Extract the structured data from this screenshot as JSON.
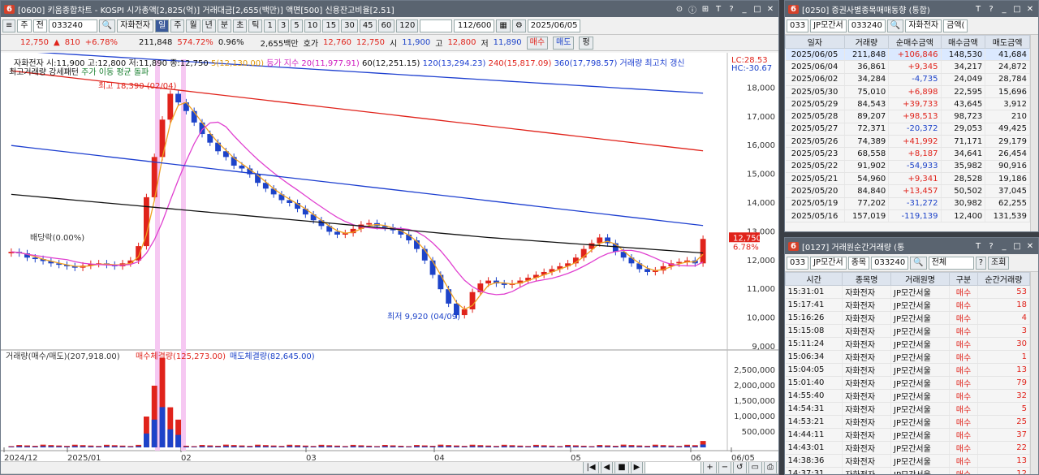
{
  "main": {
    "window_num": "6",
    "title": "[0600] 키움종합차트 - KOSPI 시가총액[2,825(억)] 거래대금[2,655(백만)] 액면[500] 신용잔고비율[2.51]",
    "toolbar1": {
      "period_type": "주",
      "prev_label": "전",
      "code": "033240",
      "stock_name": "자화전자",
      "btn_il": "일",
      "btn_ju": "주",
      "btn_wol": "월",
      "btn_nyeon": "년",
      "btn_bun": "분",
      "btn_cho": "초",
      "btn_tick": "틱",
      "n1": "1",
      "n3": "3",
      "n5": "5",
      "n10": "10",
      "n15": "15",
      "n30": "30",
      "n45": "45",
      "n60": "60",
      "n120": "120",
      "count": "112/600",
      "date": "2025/06/05"
    },
    "toolbar2": {
      "price": "12,750",
      "change": "810",
      "rate": "+6.78%",
      "volume": "211,848",
      "vol_rate": "574.72%",
      "turnover": "0.96%",
      "amount": "2,655백만",
      "hoga_label": "호가",
      "hoga1": "12,760",
      "hoga2": "12,750",
      "open_label": "시",
      "open": "11,900",
      "high_label": "고",
      "high": "12,800",
      "low_label": "저",
      "low": "11,890",
      "buy": "매수",
      "sell": "매도",
      "extra": "펑"
    },
    "legend": {
      "price_info": "자화전자 시:11,900 고:12,800 저:11,890 종:12,750",
      "ma5": "5(12,130.00)",
      "index": "등가 지수",
      "ma20": "20(11,977.91)",
      "ma60": "60(12,251.15)",
      "ma120": "120(13,294.23)",
      "ma240": "240(15,817.09)",
      "ma360": "360(17,798.57)",
      "vol_note": "거래량 최고치 갱신",
      "pattern": "최고거래량 강세패턴",
      "avg_breakout": "주가 이동 평균 돌파",
      "lc": "LC:28.53",
      "hc": "HC:-30.67"
    },
    "annotations": {
      "high": "최고 18,390 (02/04)",
      "low": "최저 9,920 (04/09)",
      "dividend": "배당락(0.00%)",
      "last_price": "12,750",
      "last_rate": "6.78%"
    },
    "yaxis": [
      "18,000",
      "17,000",
      "16,000",
      "15,000",
      "14,000",
      "13,000",
      "12,000",
      "11,000",
      "10,000",
      "9,000"
    ],
    "volume_panel": {
      "title": "거래량(매수/매도)(207,918.00)",
      "buy": "매수체결량(125,273.00)",
      "sell": "매도체결량(82,645.00)",
      "yaxis": [
        "2,500,000",
        "2,000,000",
        "1,500,000",
        "1,000,000",
        "500,000"
      ]
    },
    "xaxis": [
      "2024/12",
      "2025/01",
      "02",
      "03",
      "04",
      "05",
      "06",
      "06/05"
    ]
  },
  "chart_data": {
    "type": "candlestick",
    "ylim": [
      9000,
      19000
    ],
    "closes": [
      12300,
      12250,
      12100,
      12050,
      11980,
      11900,
      11850,
      11800,
      11750,
      11820,
      11880,
      11900,
      11850,
      11800,
      11900,
      12000,
      12500,
      14200,
      15600,
      16900,
      17800,
      17500,
      17200,
      16800,
      16400,
      16100,
      15800,
      15600,
      15300,
      15200,
      15000,
      14700,
      14500,
      14300,
      14100,
      14000,
      13800,
      13600,
      13400,
      13200,
      13000,
      12900,
      12950,
      13100,
      13250,
      13300,
      13200,
      13150,
      13050,
      12900,
      12700,
      12400,
      12000,
      11500,
      11000,
      10500,
      10100,
      10300,
      10900,
      11200,
      11300,
      11200,
      11150,
      11200,
      11300,
      11400,
      11500,
      11600,
      11700,
      11800,
      11900,
      12100,
      12400,
      12600,
      12800,
      12600,
      12300,
      12100,
      11900,
      11700,
      11600,
      11650,
      11800,
      11900,
      11950,
      12000,
      11900,
      12750
    ],
    "series": [
      {
        "name": "5",
        "color": "#f0a020"
      },
      {
        "name": "20",
        "color": "#e040d0"
      },
      {
        "name": "60",
        "color": "#111111"
      },
      {
        "name": "120",
        "color": "#1d3fd0"
      },
      {
        "name": "240",
        "color": "#e0231b"
      }
    ]
  },
  "investor": {
    "window_num": "6",
    "title": "[0250] 증권사별종목매매동향 (통합)",
    "market": "033",
    "broker": "JP모간서",
    "code": "033240",
    "stock": "자화전자",
    "unit": "금액(",
    "headers": [
      "일자",
      "거래량",
      "순매수금액",
      "매수금액",
      "매도금액"
    ],
    "rows": [
      [
        "2025/06/05",
        "211,848",
        "+106,846",
        "148,530",
        "41,684"
      ],
      [
        "2025/06/04",
        "36,861",
        "+9,345",
        "34,217",
        "24,872"
      ],
      [
        "2025/06/02",
        "34,284",
        "-4,735",
        "24,049",
        "28,784"
      ],
      [
        "2025/05/30",
        "75,010",
        "+6,898",
        "22,595",
        "15,696"
      ],
      [
        "2025/05/29",
        "84,543",
        "+39,733",
        "43,645",
        "3,912"
      ],
      [
        "2025/05/28",
        "89,207",
        "+98,513",
        "98,723",
        "210"
      ],
      [
        "2025/05/27",
        "72,371",
        "-20,372",
        "29,053",
        "49,425"
      ],
      [
        "2025/05/26",
        "74,389",
        "+41,992",
        "71,171",
        "29,179"
      ],
      [
        "2025/05/23",
        "68,558",
        "+8,187",
        "34,641",
        "26,454"
      ],
      [
        "2025/05/22",
        "91,902",
        "-54,933",
        "35,982",
        "90,916"
      ],
      [
        "2025/05/21",
        "54,960",
        "+9,341",
        "28,528",
        "19,186"
      ],
      [
        "2025/05/20",
        "84,840",
        "+13,457",
        "50,502",
        "37,045"
      ],
      [
        "2025/05/19",
        "77,202",
        "-31,272",
        "30,982",
        "62,255"
      ],
      [
        "2025/05/16",
        "157,019",
        "-119,139",
        "12,400",
        "131,539"
      ]
    ]
  },
  "trades": {
    "window_num": "6",
    "title": "[0127] 거래원순간거래량 (통",
    "market": "033",
    "broker": "JP모간서",
    "type": "종목",
    "code": "033240",
    "filter": "전체",
    "query": "조회",
    "help": "?",
    "headers": [
      "시간",
      "종목명",
      "거래원명",
      "구분",
      "순간거래량"
    ],
    "rows": [
      [
        "15:31:01",
        "자화전자",
        "JP모간서울",
        "매수",
        "53"
      ],
      [
        "15:17:41",
        "자화전자",
        "JP모간서울",
        "매수",
        "18"
      ],
      [
        "15:16:26",
        "자화전자",
        "JP모간서울",
        "매수",
        "4"
      ],
      [
        "15:15:08",
        "자화전자",
        "JP모간서울",
        "매수",
        "3"
      ],
      [
        "15:11:24",
        "자화전자",
        "JP모간서울",
        "매수",
        "30"
      ],
      [
        "15:06:34",
        "자화전자",
        "JP모간서울",
        "매수",
        "1"
      ],
      [
        "15:04:05",
        "자화전자",
        "JP모간서울",
        "매수",
        "13"
      ],
      [
        "15:01:40",
        "자화전자",
        "JP모간서울",
        "매수",
        "79"
      ],
      [
        "14:55:40",
        "자화전자",
        "JP모간서울",
        "매수",
        "32"
      ],
      [
        "14:54:31",
        "자화전자",
        "JP모간서울",
        "매수",
        "5"
      ],
      [
        "14:53:21",
        "자화전자",
        "JP모간서울",
        "매수",
        "25"
      ],
      [
        "14:44:11",
        "자화전자",
        "JP모간서울",
        "매수",
        "37"
      ],
      [
        "14:43:01",
        "자화전자",
        "JP모간서울",
        "매수",
        "22"
      ],
      [
        "14:38:36",
        "자화전자",
        "JP모간서울",
        "매수",
        "13"
      ],
      [
        "14:37:31",
        "자화전자",
        "JP모간서울",
        "매수",
        "12"
      ]
    ]
  }
}
